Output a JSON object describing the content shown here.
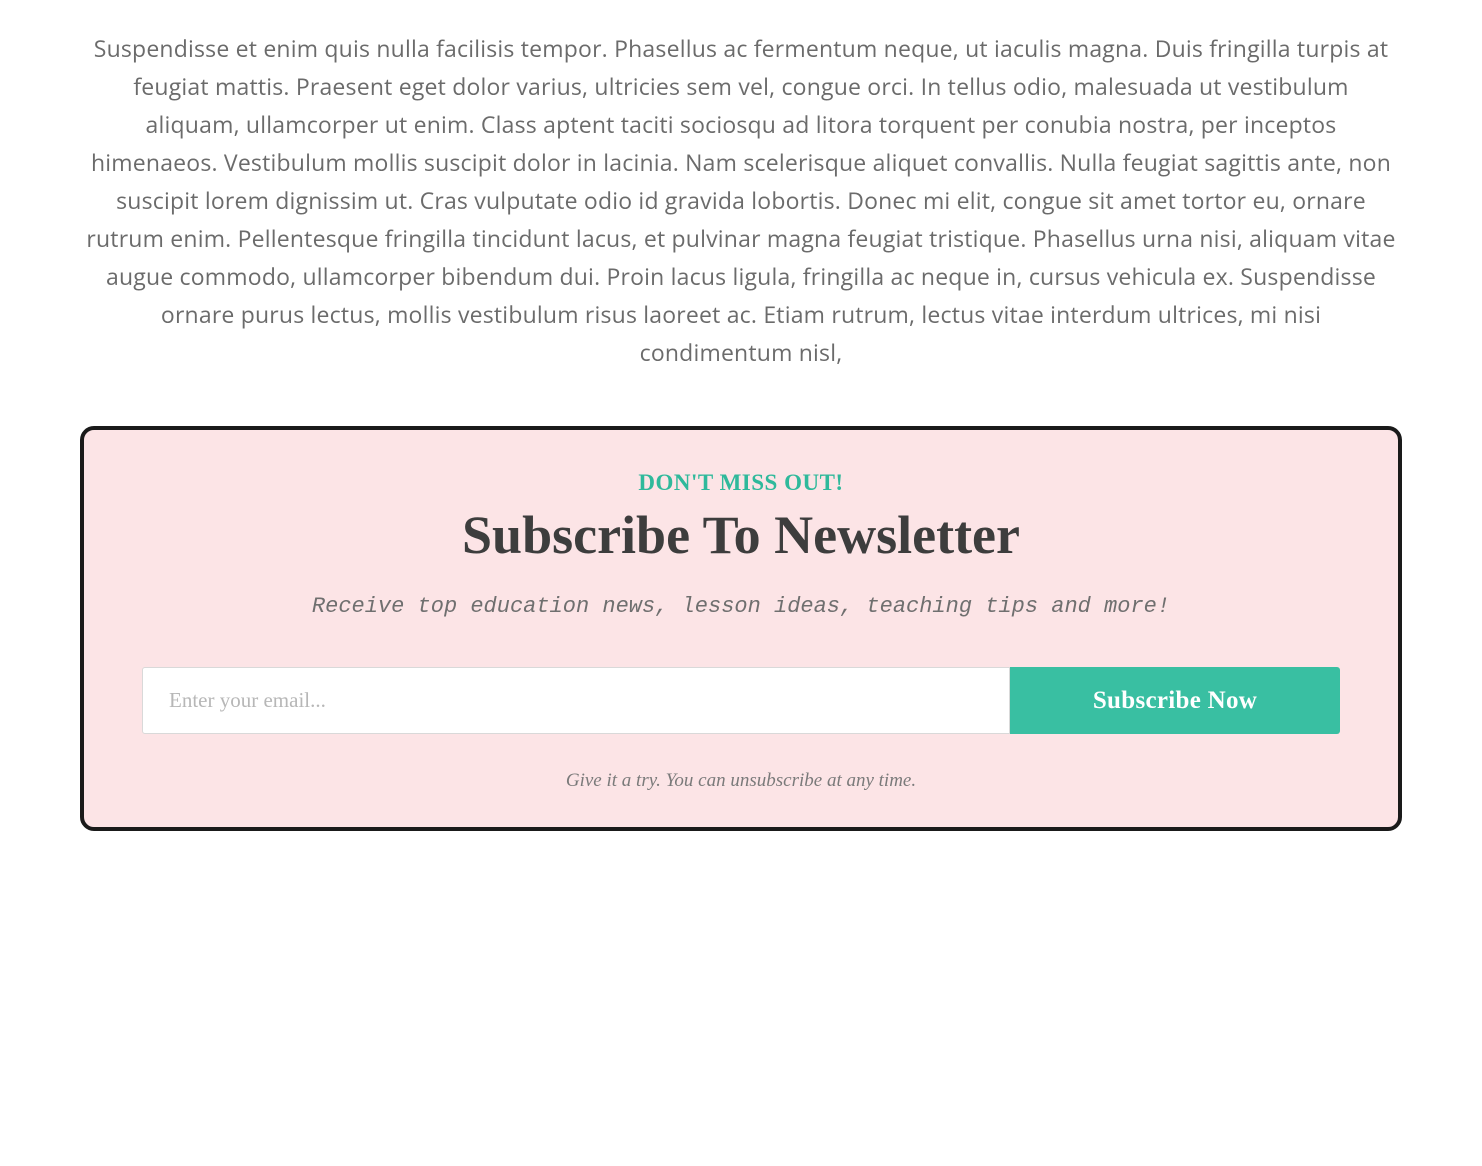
{
  "article": {
    "body": "Suspendisse et enim quis nulla facilisis tempor. Phasellus ac fermentum neque, ut iaculis magna. Duis fringilla turpis at feugiat mattis. Praesent eget dolor varius, ultricies sem vel, congue orci. In tellus odio, malesuada ut vestibulum aliquam, ullamcorper ut enim. Class aptent taciti sociosqu ad litora torquent per conubia nostra, per inceptos himenaeos. Vestibulum mollis suscipit dolor in lacinia. Nam scelerisque aliquet convallis. Nulla feugiat sagittis ante, non suscipit lorem dignissim ut. Cras vulputate odio id gravida lobortis. Donec mi elit, congue sit amet tortor eu, ornare rutrum enim. Pellentesque fringilla tincidunt lacus, et pulvinar magna feugiat tristique. Phasellus urna nisi, aliquam vitae augue commodo, ullamcorper bibendum dui. Proin lacus ligula, fringilla ac neque in, cursus vehicula ex. Suspendisse ornare purus lectus, mollis vestibulum risus laoreet ac. Etiam rutrum, lectus vitae interdum ultrices, mi nisi condimentum nisl,"
  },
  "newsletter": {
    "eyebrow": "DON'T MISS OUT!",
    "title": "Subscribe To Newsletter",
    "subtitle": "Receive top education news, lesson ideas, teaching tips and more!",
    "email_placeholder": "Enter your email...",
    "submit_label": "Subscribe Now",
    "footnote": "Give it a try. You can unsubscribe at any time."
  }
}
